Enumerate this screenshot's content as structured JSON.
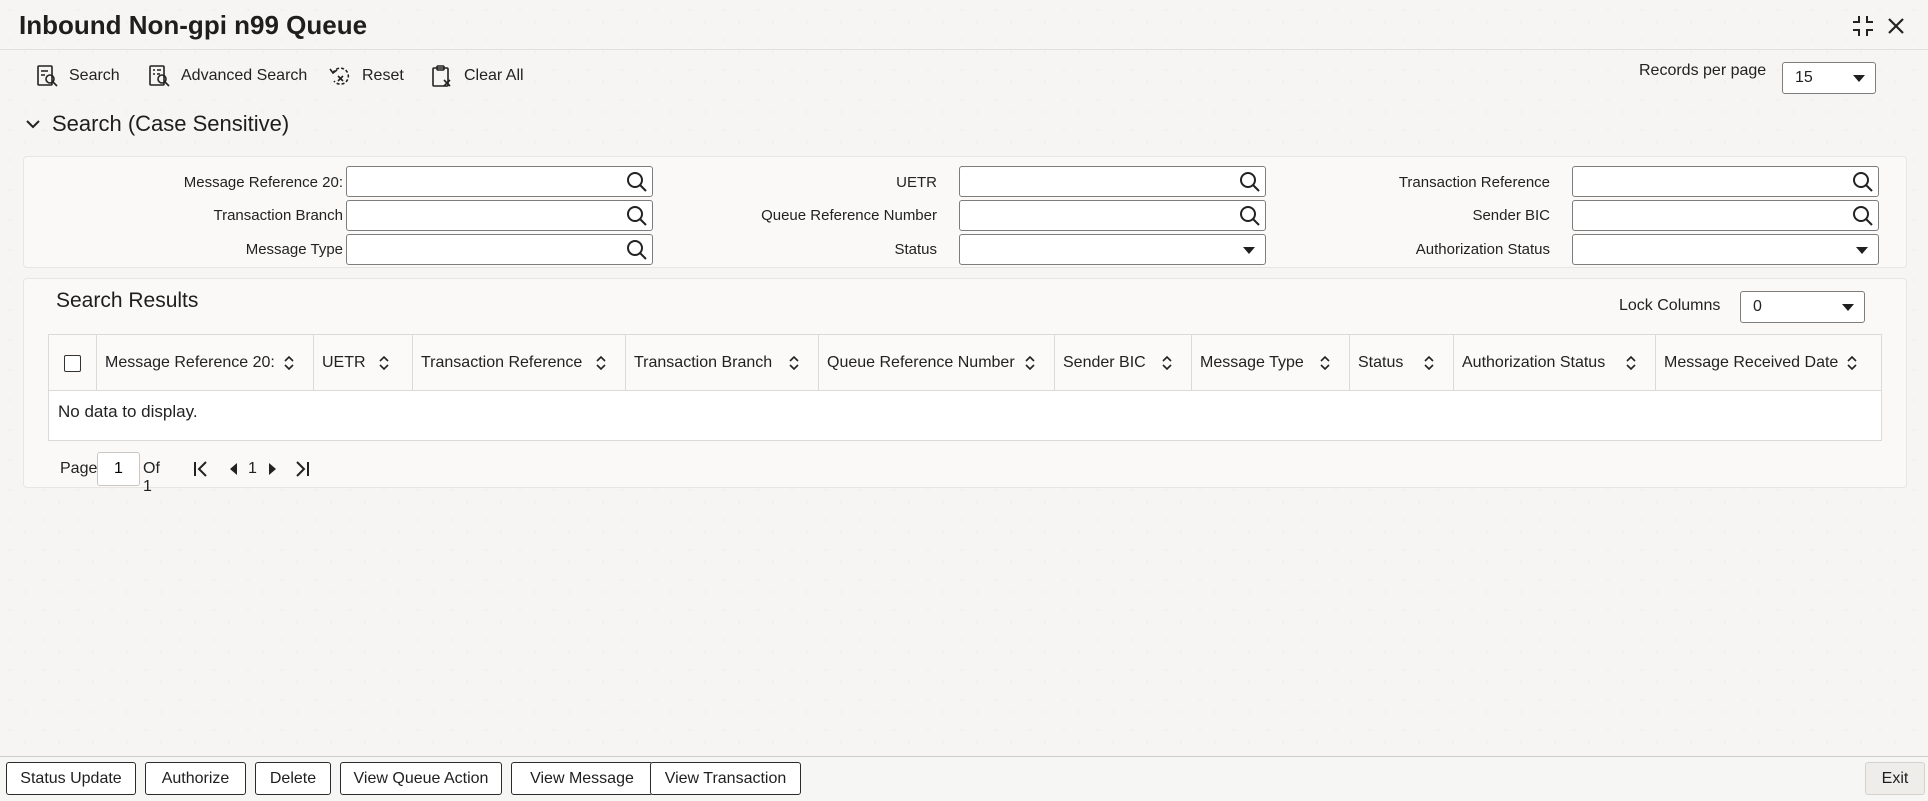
{
  "window": {
    "title": "Inbound Non-gpi n99 Queue"
  },
  "toolbar": {
    "search_label": "Search",
    "advanced_search_label": "Advanced Search",
    "reset_label": "Reset",
    "clear_all_label": "Clear All",
    "records_per_page_label": "Records per page",
    "records_per_page_value": "15"
  },
  "search_section": {
    "title": "Search (Case Sensitive)",
    "fields": {
      "message_reference_20": {
        "label": "Message Reference 20:",
        "value": ""
      },
      "uetr": {
        "label": "UETR",
        "value": ""
      },
      "transaction_reference": {
        "label": "Transaction Reference",
        "value": ""
      },
      "transaction_branch": {
        "label": "Transaction Branch",
        "value": ""
      },
      "queue_reference_number": {
        "label": "Queue Reference Number",
        "value": ""
      },
      "sender_bic": {
        "label": "Sender BIC",
        "value": ""
      },
      "message_type": {
        "label": "Message Type",
        "value": ""
      },
      "status": {
        "label": "Status",
        "value": ""
      },
      "authorization_status": {
        "label": "Authorization Status",
        "value": ""
      }
    }
  },
  "results": {
    "title": "Search Results",
    "lock_columns_label": "Lock Columns",
    "lock_columns_value": "0",
    "columns": [
      "Message Reference 20:",
      "UETR",
      "Transaction Reference",
      "Transaction Branch",
      "Queue Reference Number",
      "Sender BIC",
      "Message Type",
      "Status",
      "Authorization Status",
      "Message Received Date"
    ],
    "empty_text": "No data to display."
  },
  "pagination": {
    "page_label": "Page",
    "current_page": "1",
    "of_label": "Of 1",
    "page_link": "1"
  },
  "footer": {
    "status_update": "Status Update",
    "authorize": "Authorize",
    "delete": "Delete",
    "view_queue_action": "View Queue Action",
    "view_message": "View Message",
    "view_transaction": "View Transaction",
    "exit": "Exit"
  },
  "icons": {
    "search": "search-icon",
    "advanced_search": "advanced-search-icon",
    "reset": "reset-icon",
    "clear_all": "clear-all-icon",
    "collapse": "chevron-down-icon",
    "lookup": "magnifier-icon",
    "sort": "sort-icon",
    "maximize": "maximize-icon",
    "close": "close-icon"
  }
}
